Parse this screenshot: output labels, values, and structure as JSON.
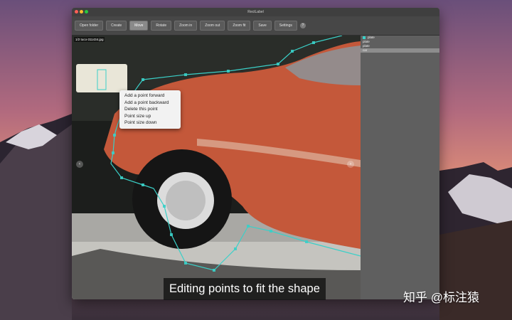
{
  "window": {
    "title": "RectLabel"
  },
  "toolbar": {
    "buttons": [
      "Open folder",
      "Create",
      "Move",
      "Rotate",
      "Zoom in",
      "Zoom out",
      "Zoom fit",
      "Save",
      "Settings"
    ],
    "active": "Move",
    "help_label": "?"
  },
  "canvas": {
    "file_tag": "1/2 tuco-311434.jpg",
    "prev_label": "‹",
    "next_label": "›"
  },
  "labels": [
    {
      "name": "plate",
      "color": "#3ad0c8"
    },
    {
      "name": "plate",
      "color": ""
    },
    {
      "name": "plate",
      "color": ""
    },
    {
      "name": "car",
      "color": ""
    }
  ],
  "context_menu": [
    "Add a point forward",
    "Add a point backward",
    "Delete this point",
    "Point size up",
    "Point size down"
  ],
  "subtitle": "Editing points to fit the shape",
  "watermark": "知乎 @标注猿",
  "colors": {
    "polygon": "#3ad0c8",
    "car_body": "#c4583a"
  }
}
